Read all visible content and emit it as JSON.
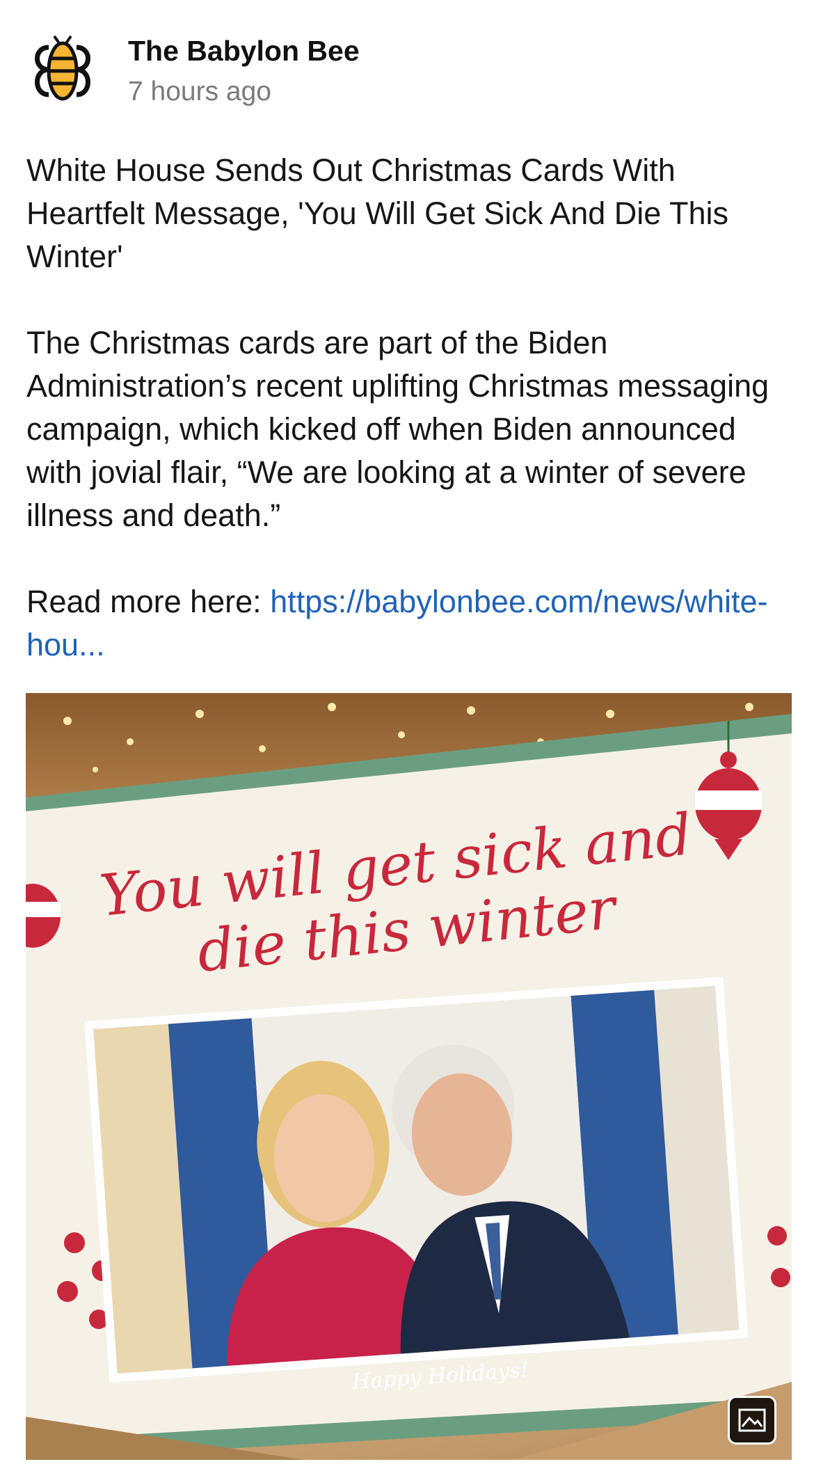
{
  "post": {
    "author": "The Babylon Bee",
    "timestamp": "7 hours ago",
    "avatar_icon": "babylon-bee-logo-icon",
    "headline": "White House Sends Out Christmas Cards With Heartfelt Message, 'You Will Get Sick And Die This Winter'",
    "body": "The Christmas cards are part of the Biden Administration’s recent uplifting Christmas messaging campaign, which kicked off when Biden announced with jovial flair, “We are looking at a winter of severe illness and death.”",
    "read_more_label": "Read more here: ",
    "link_text": "https://babylonbee.com/news/white-hou...",
    "link_color": "#1f63b8"
  },
  "image": {
    "card_text_line1": "You will get sick and",
    "card_text_line2": "die this winter",
    "card_footer": "Happy Holidays!",
    "card_text_color": "#c8283c",
    "card_border_color": "#6b9e80",
    "gallery_icon": "image-gallery-icon"
  }
}
